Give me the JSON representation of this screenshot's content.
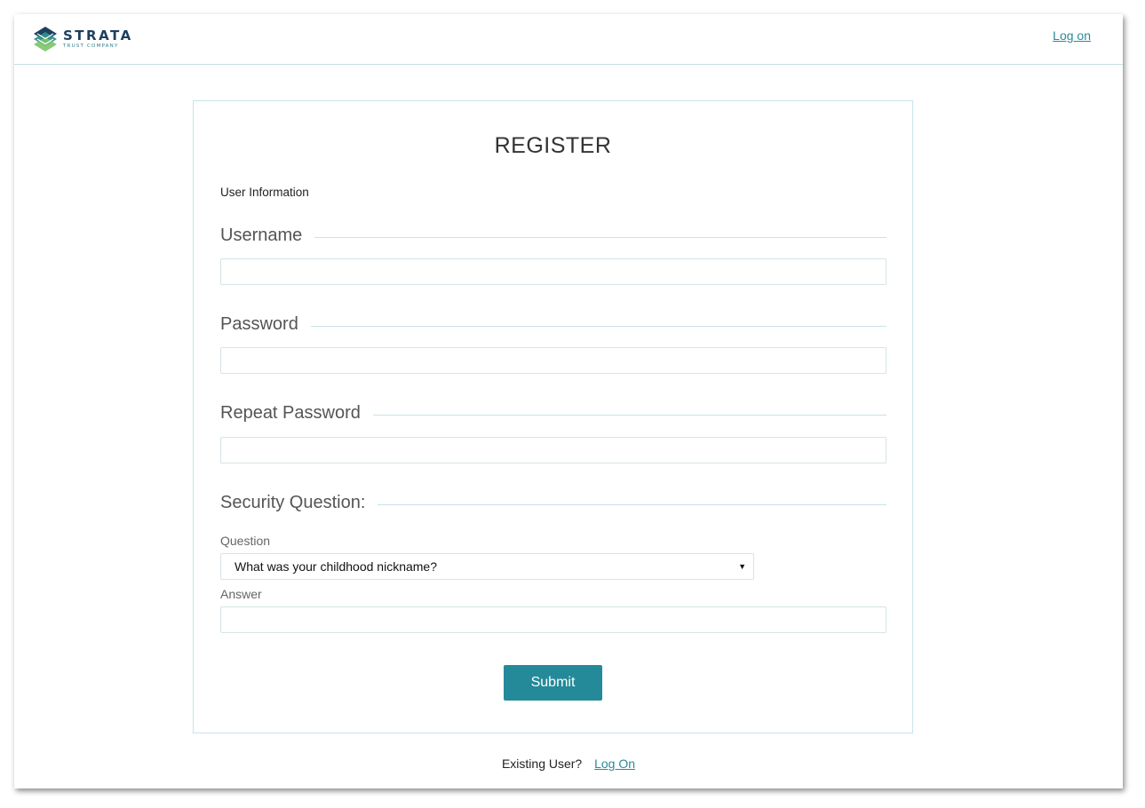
{
  "header": {
    "logo_name": "STRATA",
    "logo_sub": "TRUST COMPANY",
    "logo_icon": "strata-logo-icon",
    "log_on_link": "Log on"
  },
  "form": {
    "title": "REGISTER",
    "section_label": "User Information",
    "username": {
      "label": "Username",
      "value": ""
    },
    "password": {
      "label": "Password",
      "value": ""
    },
    "repeat_password": {
      "label": "Repeat Password",
      "value": ""
    },
    "security": {
      "heading": "Security Question:",
      "question_label": "Question",
      "question_selected": "What was your childhood nickname?",
      "answer_label": "Answer",
      "answer_value": ""
    },
    "submit_label": "Submit"
  },
  "footer": {
    "prompt": "Existing User?",
    "link": "Log On"
  },
  "colors": {
    "accent": "#248a9a",
    "link": "#2b8a98",
    "brand_navy": "#1d3f5e",
    "border": "#c8e3e8"
  }
}
